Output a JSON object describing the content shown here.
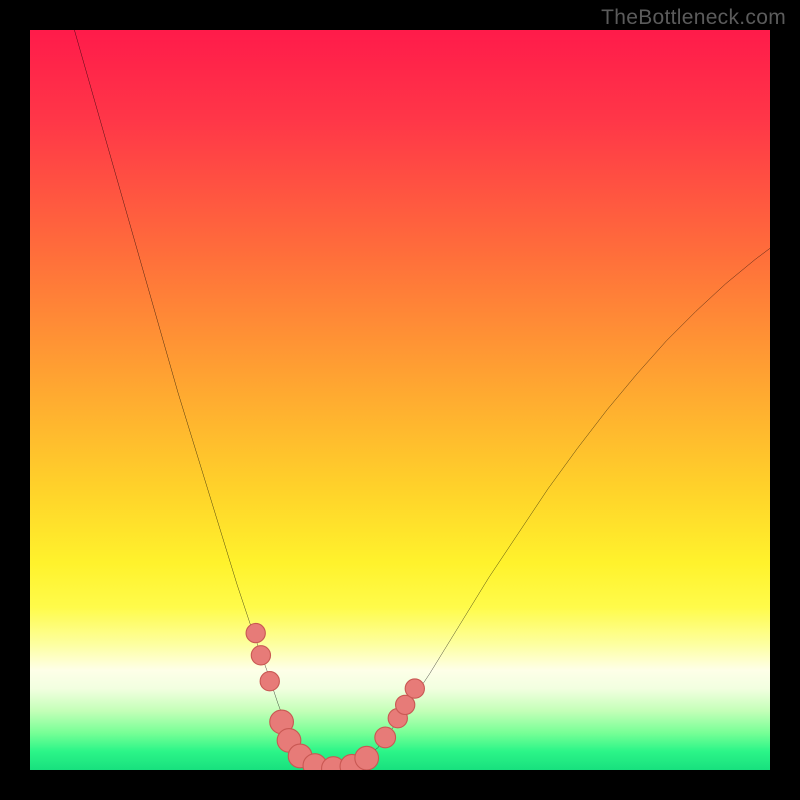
{
  "watermark": {
    "text": "TheBottleneck.com"
  },
  "colors": {
    "frame": "#000000",
    "curve": "#000000",
    "marker_fill": "#e77b78",
    "marker_stroke": "#c95853",
    "gradient_stops": [
      {
        "offset": 0.0,
        "color": "#ff1b4a"
      },
      {
        "offset": 0.12,
        "color": "#ff3648"
      },
      {
        "offset": 0.3,
        "color": "#ff6d3b"
      },
      {
        "offset": 0.48,
        "color": "#ffa631"
      },
      {
        "offset": 0.62,
        "color": "#ffd22a"
      },
      {
        "offset": 0.72,
        "color": "#fff22c"
      },
      {
        "offset": 0.78,
        "color": "#fffb4a"
      },
      {
        "offset": 0.83,
        "color": "#fdffa0"
      },
      {
        "offset": 0.865,
        "color": "#feffe8"
      },
      {
        "offset": 0.89,
        "color": "#f2ffe0"
      },
      {
        "offset": 0.92,
        "color": "#c4ffb8"
      },
      {
        "offset": 0.95,
        "color": "#77ff96"
      },
      {
        "offset": 0.975,
        "color": "#2bf588"
      },
      {
        "offset": 1.0,
        "color": "#18e07e"
      }
    ]
  },
  "chart_data": {
    "type": "line",
    "title": "",
    "xlabel": "",
    "ylabel": "",
    "x_range": [
      0,
      100
    ],
    "y_range": [
      0,
      100
    ],
    "series": [
      {
        "name": "bottleneck-curve",
        "x": [
          6,
          8,
          10,
          12,
          14,
          16,
          18,
          20,
          22,
          24,
          26,
          28,
          30,
          32,
          33.5,
          35,
          36.5,
          38,
          40,
          42,
          44,
          47,
          50,
          54,
          58,
          62,
          66,
          70,
          74,
          78,
          82,
          86,
          90,
          94,
          98,
          100
        ],
        "y": [
          100,
          93,
          86,
          79,
          72,
          65,
          58,
          51,
          44.5,
          38,
          31.5,
          25,
          19,
          13.5,
          9,
          5,
          2.2,
          0.8,
          0,
          0,
          0.8,
          3,
          7,
          13,
          19.5,
          26,
          32,
          38,
          43.5,
          48.7,
          53.5,
          58,
          62,
          65.7,
          69,
          70.5
        ]
      }
    ],
    "markers": [
      {
        "x": 30.5,
        "y": 18.5,
        "r": 1.3
      },
      {
        "x": 31.2,
        "y": 15.5,
        "r": 1.3
      },
      {
        "x": 32.4,
        "y": 12.0,
        "r": 1.3
      },
      {
        "x": 34.0,
        "y": 6.5,
        "r": 1.6
      },
      {
        "x": 35.0,
        "y": 4.0,
        "r": 1.6
      },
      {
        "x": 36.5,
        "y": 1.9,
        "r": 1.6
      },
      {
        "x": 38.5,
        "y": 0.6,
        "r": 1.6
      },
      {
        "x": 41.0,
        "y": 0.2,
        "r": 1.6
      },
      {
        "x": 43.5,
        "y": 0.5,
        "r": 1.6
      },
      {
        "x": 45.5,
        "y": 1.6,
        "r": 1.6
      },
      {
        "x": 48.0,
        "y": 4.4,
        "r": 1.4
      },
      {
        "x": 49.7,
        "y": 7.0,
        "r": 1.3
      },
      {
        "x": 50.7,
        "y": 8.8,
        "r": 1.3
      },
      {
        "x": 52.0,
        "y": 11.0,
        "r": 1.3
      }
    ]
  }
}
